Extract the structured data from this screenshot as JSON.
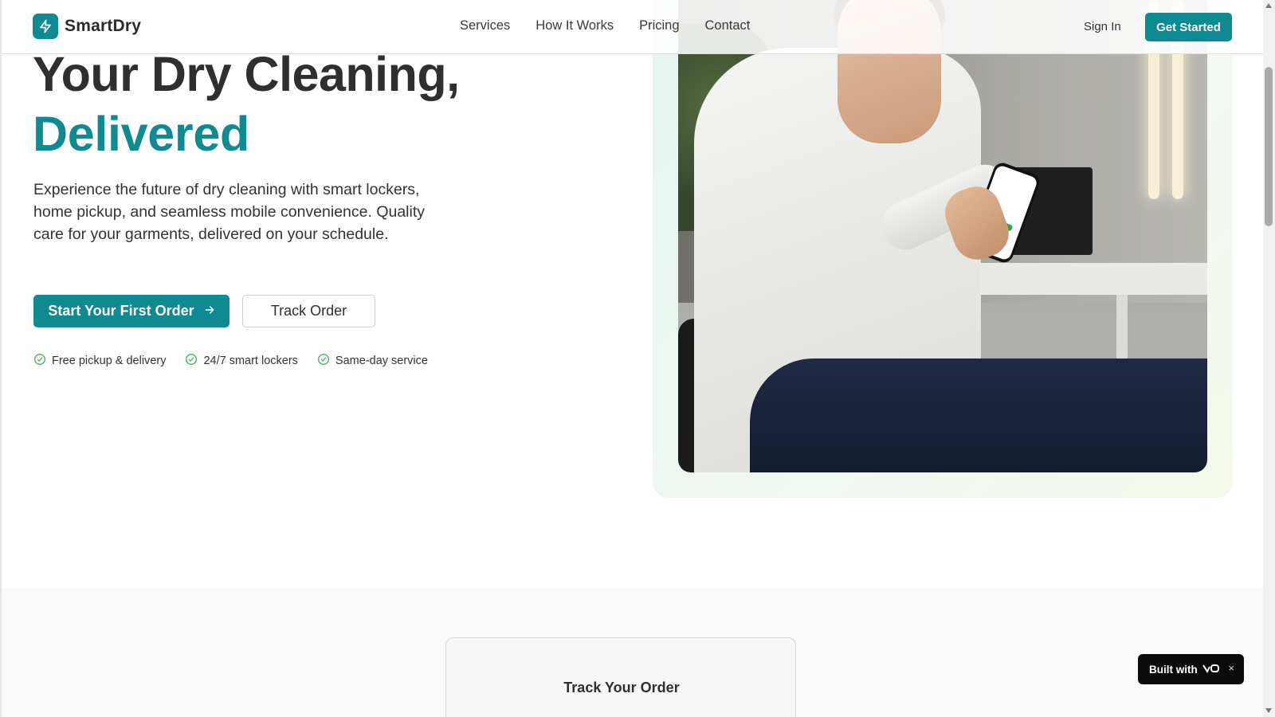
{
  "brand": {
    "name": "SmartDry",
    "accent": "#0e8a93"
  },
  "nav": {
    "items": [
      "Services",
      "How It Works",
      "Pricing",
      "Contact"
    ],
    "sign_in": "Sign In",
    "get_started": "Get Started"
  },
  "hero": {
    "headline_line1": "Your Dry Cleaning,",
    "headline_line2": "Delivered",
    "lead": "Experience the future of dry cleaning with smart lockers, home pickup, and seamless mobile convenience. Quality care for your garments, delivered on your schedule.",
    "primary_button": "Start Your First Order",
    "secondary_button": "Track Order",
    "features": [
      "Free pickup & delivery",
      "24/7 smart lockers",
      "Same-day service"
    ]
  },
  "track": {
    "title": "Track Your Order"
  },
  "badge": {
    "label": "Built with",
    "logo": "v0-logo-icon",
    "close": "×"
  }
}
